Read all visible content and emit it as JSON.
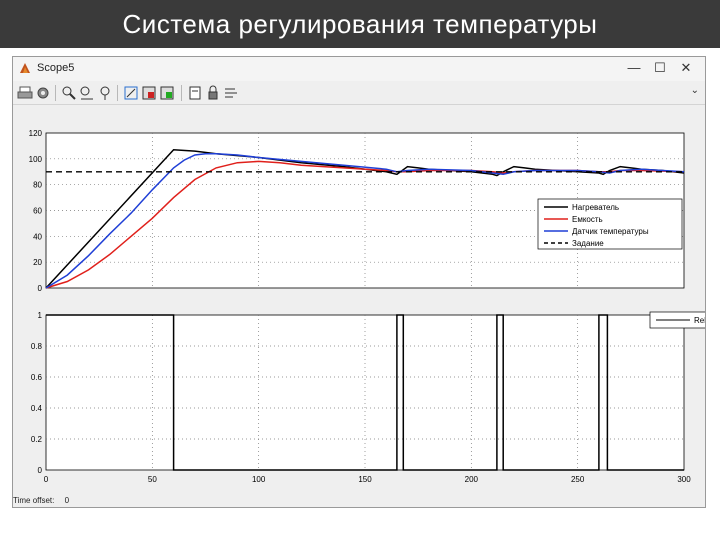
{
  "slide": {
    "title": "Система регулирования температуры"
  },
  "window": {
    "title": "Scope5",
    "minimize": "—",
    "maximize": "☐",
    "close": "✕",
    "toolbar_icons": [
      "print-icon",
      "parameters-icon",
      "zoom-in-icon",
      "zoom-x-icon",
      "zoom-y-icon",
      "autoscale-icon",
      "save-axes-icon",
      "restore-axes-icon",
      "floating-scope-icon",
      "lock-axes-icon",
      "signal-selector-icon"
    ],
    "dropdown_glyph": "⌄"
  },
  "colors": {
    "heater": "#000000",
    "vessel": "#e0201b",
    "sensor": "#1f3fd6",
    "setpoint": "#000000",
    "relay": "#000000",
    "axes_bg": "#ffffff",
    "window_bg": "#efefef"
  },
  "chart_data": [
    {
      "type": "line",
      "xlim": [
        0,
        300
      ],
      "ylim": [
        0,
        120
      ],
      "yticks": [
        "0",
        "20",
        "40",
        "60",
        "80",
        "100",
        "120"
      ],
      "grid": true,
      "legend_position": "right",
      "series": [
        {
          "name": "Нагреватель",
          "color": "#000000",
          "style": "solid",
          "x": [
            0,
            60,
            70,
            80,
            100,
            120,
            140,
            150,
            160,
            165,
            170,
            175,
            180,
            190,
            200,
            210,
            212,
            215,
            220,
            225,
            230,
            240,
            250,
            260,
            262,
            265,
            270,
            275,
            280,
            290,
            300
          ],
          "y": [
            0,
            107,
            106,
            104,
            101,
            97,
            94,
            92,
            90,
            88,
            94,
            93,
            92,
            91,
            90,
            88,
            87,
            90,
            94,
            93,
            92,
            91,
            90,
            89,
            88,
            91,
            94,
            93,
            92,
            91,
            89
          ]
        },
        {
          "name": "Емкость",
          "color": "#e0201b",
          "style": "solid",
          "x": [
            0,
            10,
            20,
            30,
            40,
            50,
            60,
            70,
            80,
            90,
            100,
            110,
            120,
            140,
            160,
            165,
            170,
            180,
            200,
            210,
            215,
            220,
            230,
            250,
            260,
            265,
            270,
            280,
            300
          ],
          "y": [
            0,
            5,
            14,
            26,
            40,
            54,
            70,
            84,
            93,
            97,
            98,
            97,
            95,
            93,
            91,
            90,
            90,
            91,
            91,
            90,
            89,
            90,
            91,
            91,
            90,
            90,
            91,
            91,
            90
          ]
        },
        {
          "name": "Датчик температуры",
          "color": "#1f3fd6",
          "style": "solid",
          "x": [
            0,
            10,
            20,
            30,
            40,
            50,
            60,
            65,
            70,
            75,
            80,
            90,
            100,
            120,
            140,
            160,
            165,
            170,
            180,
            200,
            210,
            215,
            220,
            230,
            250,
            260,
            265,
            270,
            280,
            300
          ],
          "y": [
            0,
            10,
            25,
            42,
            58,
            76,
            93,
            99,
            103,
            104,
            104,
            103,
            101,
            98,
            95,
            92,
            90,
            91,
            92,
            91,
            89,
            88,
            90,
            91,
            91,
            90,
            89,
            91,
            92,
            90
          ]
        },
        {
          "name": "Задание",
          "color": "#000000",
          "style": "dashed",
          "x": [
            0,
            300
          ],
          "y": [
            90,
            90
          ]
        }
      ]
    },
    {
      "type": "line",
      "xlim": [
        0,
        300
      ],
      "ylim": [
        0,
        1
      ],
      "xticks": [
        "0",
        "50",
        "100",
        "150",
        "200",
        "250",
        "300"
      ],
      "yticks": [
        "0",
        "0.2",
        "0.4",
        "0.6",
        "0.8",
        "1"
      ],
      "grid": true,
      "legend_position": "top-right",
      "series": [
        {
          "name": "Relay",
          "color": "#000000",
          "style": "solid",
          "x": [
            0,
            60,
            60,
            165,
            165,
            168,
            168,
            212,
            212,
            215,
            215,
            260,
            260,
            264,
            264,
            300
          ],
          "y": [
            1,
            1,
            0,
            0,
            1,
            1,
            0,
            0,
            1,
            1,
            0,
            0,
            1,
            1,
            0,
            0
          ]
        }
      ]
    }
  ],
  "footer": {
    "label": "Time offset:",
    "value": "0"
  }
}
